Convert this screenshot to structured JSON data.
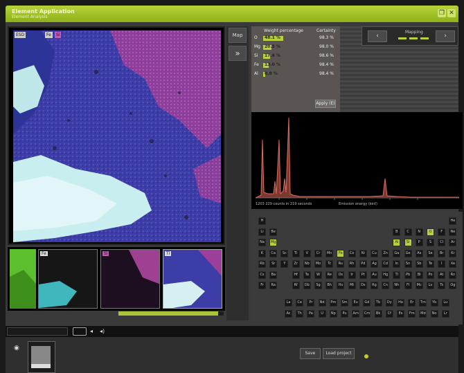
{
  "title": {
    "app": "Element Application",
    "subtitle": "Element Analysis"
  },
  "window": {
    "close_glyph": "✕",
    "restore_glyph": "❐"
  },
  "image_panel": {
    "badge_left": "ESD",
    "badge_fe": "Fe",
    "badge_si": "Si"
  },
  "side": {
    "map_label": "Map",
    "expand_glyph": "»"
  },
  "thumbnails": [
    {
      "tag": ""
    },
    {
      "tag": "Fe"
    },
    {
      "tag": "Si"
    },
    {
      "tag": "Ti"
    }
  ],
  "progress": {
    "fraction": 0.95
  },
  "quant": {
    "header_weight": "Weight percentage",
    "header_cert": "Certainty",
    "rows": [
      {
        "el": "O",
        "pct": "48.1 %",
        "cert": "98.3 %",
        "fraction": 0.48
      },
      {
        "el": "Mg",
        "pct": "20.5 %",
        "cert": "98.0 %",
        "fraction": 0.2
      },
      {
        "el": "Si",
        "pct": "17.6 %",
        "cert": "98.6 %",
        "fraction": 0.17
      },
      {
        "el": "Fe",
        "pct": "13.0 %",
        "cert": "98.4 %",
        "fraction": 0.13
      },
      {
        "el": "Al",
        "pct": "0.8 %",
        "cert": "98.4 %",
        "fraction": 0.01
      }
    ],
    "apply_label": "Apply (E)"
  },
  "mapping": {
    "label": "Mapping",
    "prev_glyph": "‹",
    "next_glyph": "›"
  },
  "spectrum": {
    "caption_left": "1203 229 counts in 219 seconds",
    "caption_center": "Emission energy (keV)"
  },
  "periodic": {
    "selected": [
      "O",
      "Mg",
      "Al",
      "Si",
      "Fe"
    ]
  },
  "bottom": {
    "play_glyph": "◂",
    "volume_glyph": "◂)",
    "save_label": "Save",
    "load_label": "Load project",
    "eye_glyph": "◉"
  },
  "colors": {
    "accent": "#b8d13c",
    "spectrum": "#e06a5a"
  }
}
